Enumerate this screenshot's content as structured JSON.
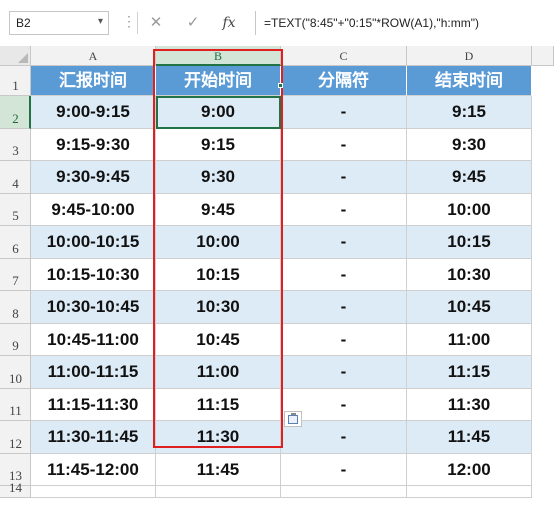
{
  "formula_bar": {
    "name_box": "B2",
    "name_box_arrow": "▾",
    "cancel_glyph": "✕",
    "enter_glyph": "✓",
    "fx_label": "fx",
    "formula": "=TEXT(\"8:45\"+\"0:15\"*ROW(A1),\"h:mm\")"
  },
  "columns": [
    "A",
    "B",
    "C",
    "D"
  ],
  "rows": [
    "1",
    "2",
    "3",
    "4",
    "5",
    "6",
    "7",
    "8",
    "9",
    "10",
    "11",
    "12",
    "13",
    "14"
  ],
  "table": {
    "headers": [
      "汇报时间",
      "开始时间",
      "分隔符",
      "结束时间"
    ],
    "rows": [
      [
        "9:00-9:15",
        "9:00",
        "-",
        "9:15"
      ],
      [
        "9:15-9:30",
        "9:15",
        "-",
        "9:30"
      ],
      [
        "9:30-9:45",
        "9:30",
        "-",
        "9:45"
      ],
      [
        "9:45-10:00",
        "9:45",
        "-",
        "10:00"
      ],
      [
        "10:00-10:15",
        "10:00",
        "-",
        "10:15"
      ],
      [
        "10:15-10:30",
        "10:15",
        "-",
        "10:30"
      ],
      [
        "10:30-10:45",
        "10:30",
        "-",
        "10:45"
      ],
      [
        "10:45-11:00",
        "10:45",
        "-",
        "11:00"
      ],
      [
        "11:00-11:15",
        "11:00",
        "-",
        "11:15"
      ],
      [
        "11:15-11:30",
        "11:15",
        "-",
        "11:30"
      ],
      [
        "11:30-11:45",
        "11:30",
        "-",
        "11:45"
      ],
      [
        "11:45-12:00",
        "11:45",
        "-",
        "12:00"
      ]
    ]
  },
  "colors": {
    "header_fill": "#5b9bd5",
    "band_fill": "#ddebf7",
    "highlight_box": "#e02020",
    "selection": "#217346"
  }
}
